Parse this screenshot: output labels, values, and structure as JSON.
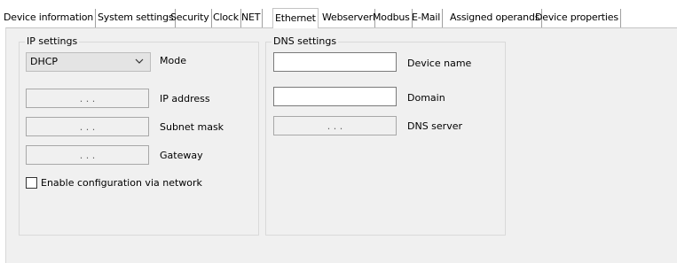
{
  "tabs": [
    {
      "label": "Device information",
      "active": false
    },
    {
      "label": "System settings",
      "active": false
    },
    {
      "label": "Security",
      "active": false
    },
    {
      "label": "Clock",
      "active": false
    },
    {
      "label": "NET",
      "active": false
    },
    {
      "label": "Ethernet",
      "active": true
    },
    {
      "label": "Webserver",
      "active": false
    },
    {
      "label": "Modbus",
      "active": false
    },
    {
      "label": "E-Mail",
      "active": false
    },
    {
      "label": "Assigned operands",
      "active": false
    },
    {
      "label": "Device properties",
      "active": false
    }
  ],
  "ip_settings": {
    "title": "IP settings",
    "mode_value": "DHCP",
    "mode_label": "Mode",
    "ip_address_label": "IP address",
    "subnet_mask_label": "Subnet mask",
    "gateway_label": "Gateway",
    "ip_placeholder": ".     .     .",
    "checkbox_label": "Enable configuration via network",
    "checkbox_checked": false
  },
  "dns_settings": {
    "title": "DNS settings",
    "device_name_label": "Device name",
    "device_name_value": "",
    "domain_label": "Domain",
    "domain_value": "",
    "dns_server_label": "DNS server"
  }
}
